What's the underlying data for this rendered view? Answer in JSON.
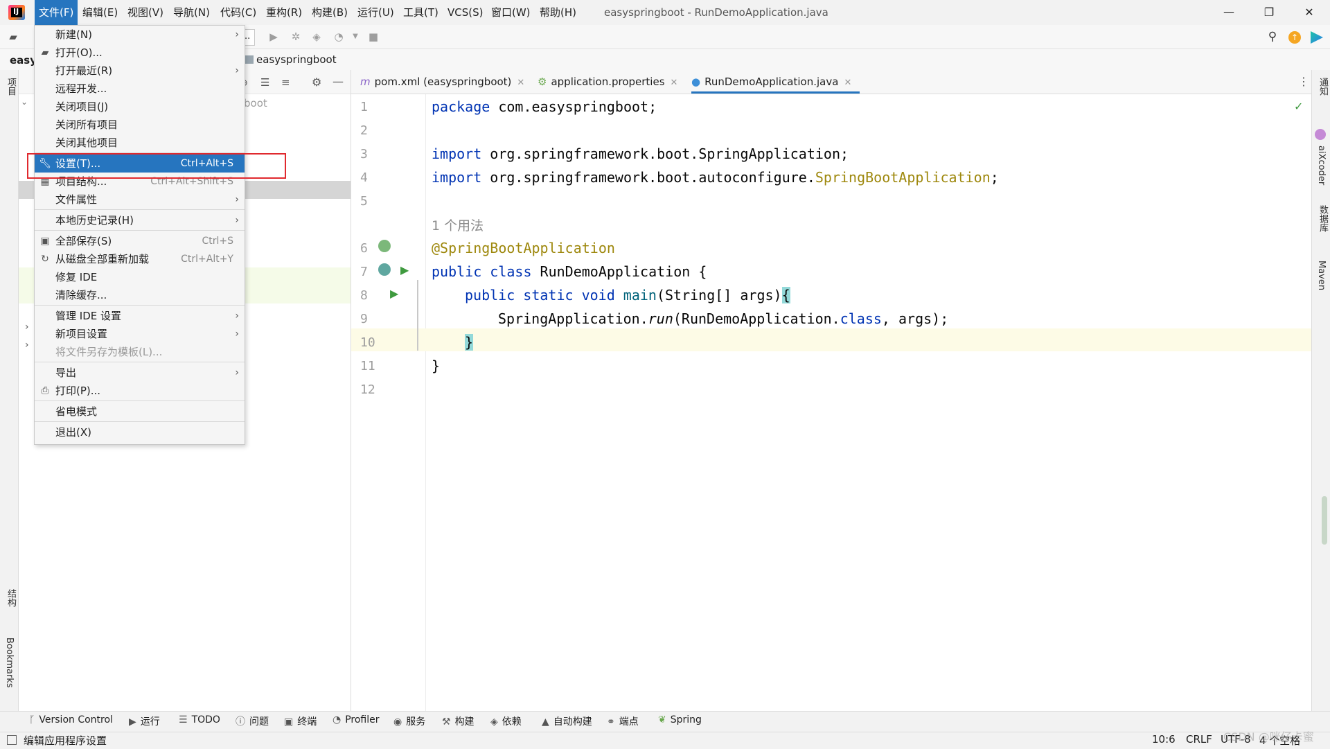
{
  "app": {
    "logo": "IJ",
    "window_title": "easyspringboot - RunDemoApplication.java"
  },
  "menubar": [
    {
      "label": "文件(F)"
    },
    {
      "label": "编辑(E)"
    },
    {
      "label": "视图(V)"
    },
    {
      "label": "导航(N)"
    },
    {
      "label": "代码(C)"
    },
    {
      "label": "重构(R)"
    },
    {
      "label": "构建(B)"
    },
    {
      "label": "运行(U)"
    },
    {
      "label": "工具(T)"
    },
    {
      "label": "VCS(S)"
    },
    {
      "label": "窗口(W)"
    },
    {
      "label": "帮助(H)"
    }
  ],
  "window_controls": {
    "minimize": "—",
    "restore": "❐",
    "close": "✕"
  },
  "breadcrumb": {
    "project_short": "easy",
    "module": "easyspringboot",
    "combo_text": "..",
    "tree_hint": "boot"
  },
  "file_menu": {
    "items": [
      {
        "label": "新建(N)",
        "arrow": "›"
      },
      {
        "label": "打开(O)...",
        "icon": "folder-icon"
      },
      {
        "label": "打开最近(R)",
        "arrow": "›"
      },
      {
        "label": "远程开发..."
      },
      {
        "label": "关闭项目(J)"
      },
      {
        "label": "关闭所有项目"
      },
      {
        "label": "关闭其他项目"
      },
      {
        "label": "设置(T)...",
        "shortcut": "Ctrl+Alt+S",
        "icon": "wrench-icon"
      },
      {
        "label": "项目结构...",
        "shortcut": "Ctrl+Alt+Shift+S",
        "icon": "project-structure-icon"
      },
      {
        "label": "文件属性",
        "arrow": "›"
      },
      {
        "label": "本地历史记录(H)",
        "arrow": "›"
      },
      {
        "label": "全部保存(S)",
        "shortcut": "Ctrl+S",
        "icon": "save-icon"
      },
      {
        "label": "从磁盘全部重新加载",
        "shortcut": "Ctrl+Alt+Y",
        "icon": "reload-icon"
      },
      {
        "label": "修复 IDE"
      },
      {
        "label": "清除缓存..."
      },
      {
        "label": "管理 IDE 设置",
        "arrow": "›"
      },
      {
        "label": "新项目设置",
        "arrow": "›"
      },
      {
        "label": "将文件另存为模板(L)...",
        "disabled": true
      },
      {
        "label": "导出",
        "arrow": "›"
      },
      {
        "label": "打印(P)...",
        "icon": "print-icon"
      },
      {
        "label": "省电模式"
      },
      {
        "label": "退出(X)"
      }
    ]
  },
  "tabs": [
    {
      "label": "pom.xml (easyspringboot)",
      "icon": "maven-icon"
    },
    {
      "label": "application.properties",
      "icon": "spring-properties-icon"
    },
    {
      "label": "RunDemoApplication.java",
      "icon": "java-class-icon",
      "active": true
    }
  ],
  "editor": {
    "line_numbers": [
      "1",
      "2",
      "3",
      "4",
      "5",
      "6",
      "7",
      "8",
      "9",
      "10",
      "11",
      "12"
    ],
    "usage_hint": "1 个用法",
    "code": {
      "l1_kw": "package",
      "l1_rest": " com.easyspringboot;",
      "l3_kw": "import",
      "l3_rest": " org.springframework.boot.SpringApplication;",
      "l4_kw": "import",
      "l4_rest": " org.springframework.boot.autoconfigure.",
      "l4_ann": "SpringBootApplication",
      "l4_end": ";",
      "l6_ann": "@SpringBootApplication",
      "l7_kw": "public class",
      "l7_rest": " RunDemoApplication {",
      "l8_kw": "public static void",
      "l8_method": " main",
      "l8_rest": "(String[] args)",
      "l8_brace": "{",
      "l9_a": "SpringApplication.",
      "l9_run": "run",
      "l9_b": "(RunDemoApplication.",
      "l9_kw": "class",
      "l9_c": ", args);",
      "l10_brace": "}",
      "l11": "}"
    }
  },
  "right_stripe": [
    {
      "label": "通知"
    },
    {
      "label": "aiXcoder"
    },
    {
      "label": "数据库"
    },
    {
      "label": "Maven"
    }
  ],
  "left_stripe": [
    {
      "label": "项目"
    },
    {
      "label": "结构"
    },
    {
      "label": "Bookmarks"
    }
  ],
  "bottom_tools": [
    {
      "label": "Version Control",
      "icon": "branch-icon"
    },
    {
      "label": "运行",
      "icon": "run-icon"
    },
    {
      "label": "TODO",
      "icon": "list-icon"
    },
    {
      "label": "问题",
      "icon": "info-icon"
    },
    {
      "label": "终端",
      "icon": "terminal-icon"
    },
    {
      "label": "Profiler",
      "icon": "profiler-icon"
    },
    {
      "label": "服务",
      "icon": "services-icon"
    },
    {
      "label": "构建",
      "icon": "hammer-icon"
    },
    {
      "label": "依赖",
      "icon": "dependencies-icon"
    },
    {
      "label": "自动构建",
      "icon": "warning-icon"
    },
    {
      "label": "端点",
      "icon": "endpoints-icon"
    },
    {
      "label": "Spring",
      "icon": "spring-icon"
    }
  ],
  "status": {
    "message": "编辑应用程序设置",
    "position": "10:6",
    "line_ending": "CRLF",
    "encoding": "UTF-8",
    "indent": "4 个空格",
    "watermark": "CSDN @咪仔卡蜜"
  },
  "colors": {
    "accent": "#2675bf",
    "highlight_box": "#e0292e",
    "keyword": "#0033b3",
    "annotation": "#9e880d"
  }
}
